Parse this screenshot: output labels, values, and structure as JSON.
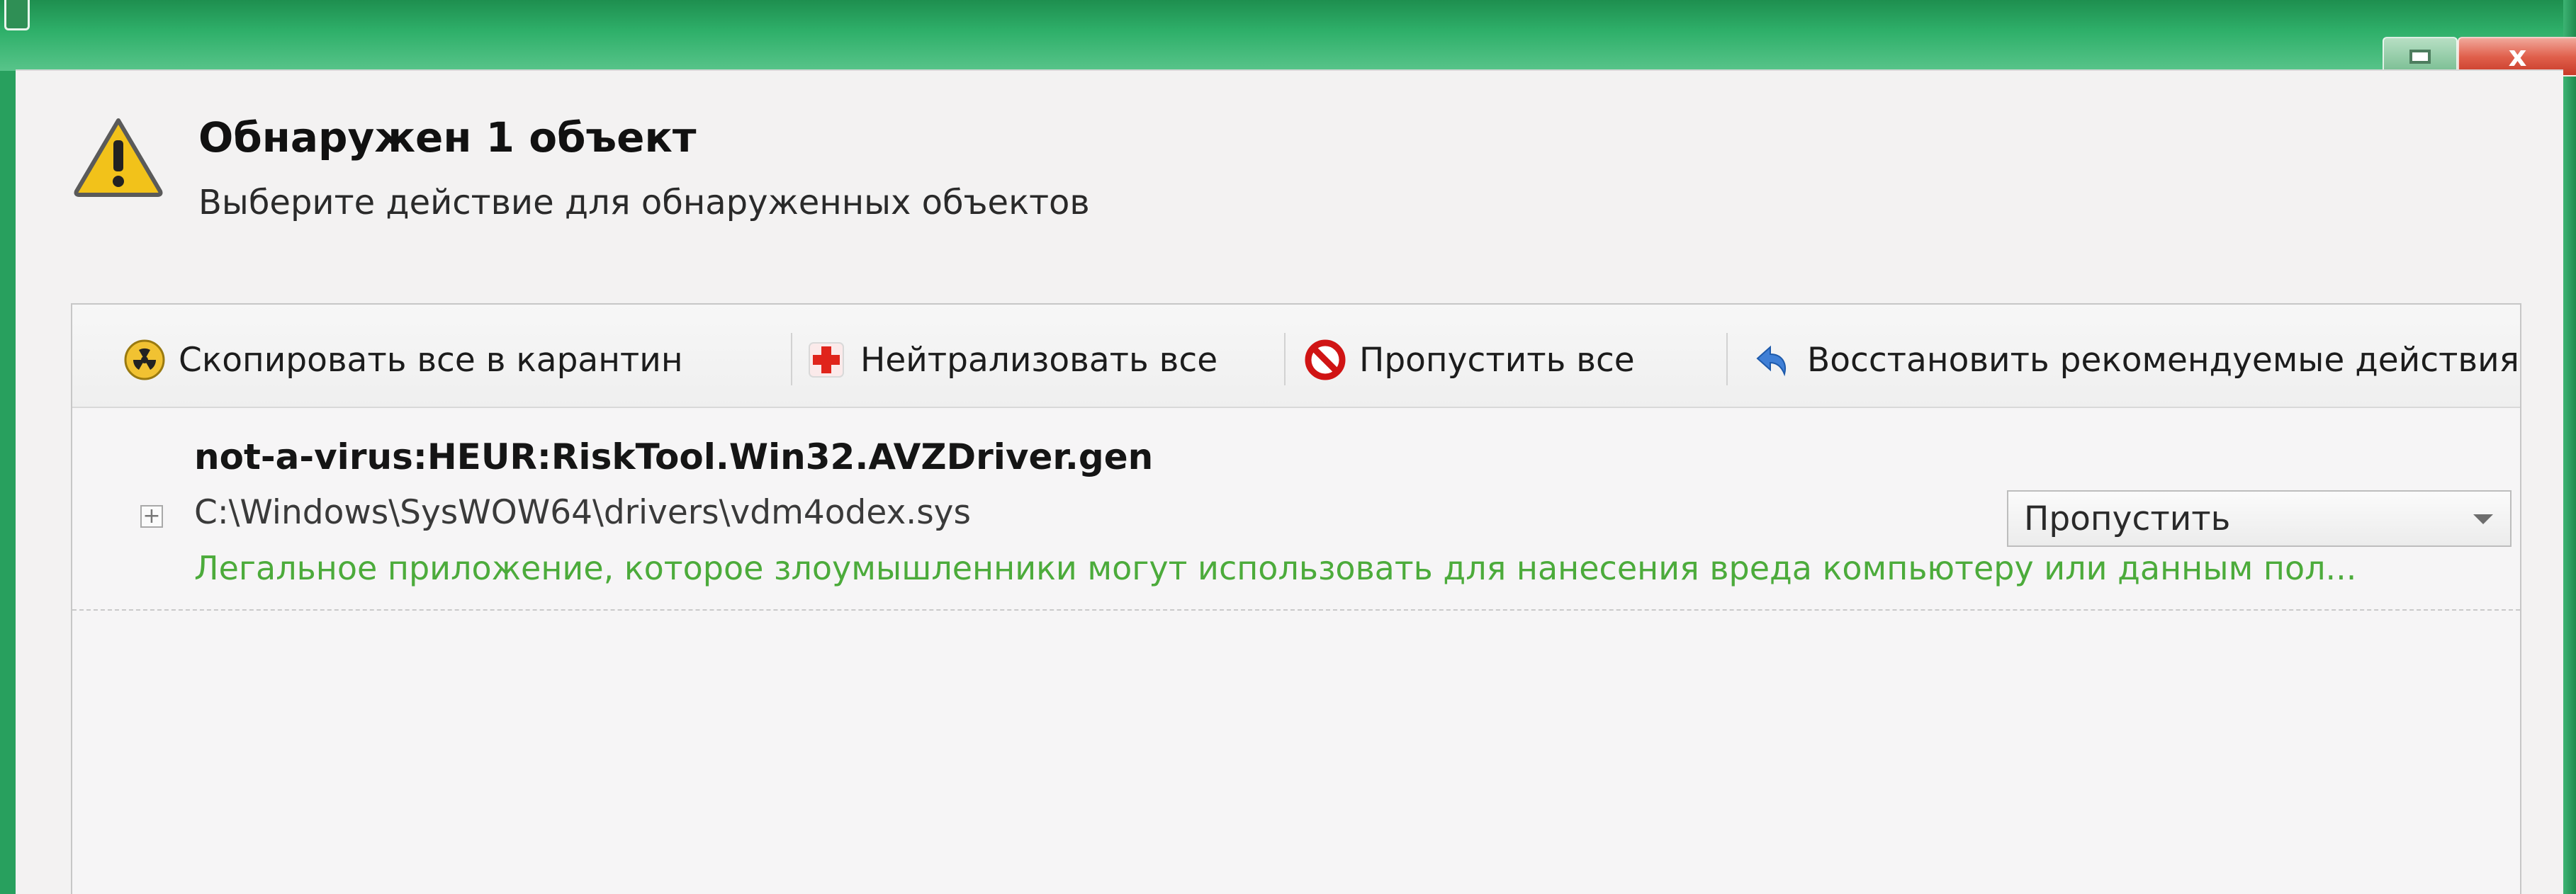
{
  "window": {
    "restore_icon": "restore-icon",
    "close_label": "x"
  },
  "header": {
    "icon": "warning-icon",
    "title": "Обнаружен 1 объект",
    "subtitle": "Выберите действие для обнаруженных объектов"
  },
  "toolbar": {
    "quarantine_all": "Скопировать все в карантин",
    "neutralize_all": "Нейтрализовать все",
    "skip_all": "Пропустить все",
    "restore_recommended": "Восстановить рекомендуемые действия"
  },
  "threat": {
    "name": "not-a-virus:HEUR:RiskTool.Win32.AVZDriver.gen",
    "path": "C:\\Windows\\SysWOW64\\drivers\\vdm4odex.sys",
    "description": "Легальное приложение, которое злоумышленники могут использовать для нанесения вреда компьютеру или данным пол...",
    "action": "Пропустить",
    "expand_symbol": "+"
  },
  "colors": {
    "frame": "#28a05e",
    "description_text": "#4cab3b",
    "close_button": "#d9503c"
  }
}
